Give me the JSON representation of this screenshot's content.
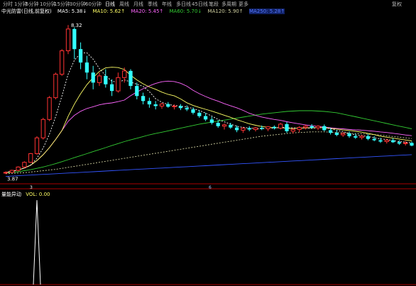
{
  "topbar": {
    "tabs": [
      {
        "label": "分时",
        "active": false
      },
      {
        "label": "1分钟",
        "active": false
      },
      {
        "label": "5分钟",
        "active": false
      },
      {
        "label": "10分钟",
        "active": false
      },
      {
        "label": "15分钟",
        "active": false
      },
      {
        "label": "30分钟",
        "active": false
      },
      {
        "label": "60分钟",
        "active": false
      },
      {
        "label": "日线",
        "active": true
      },
      {
        "label": "周线",
        "active": false
      },
      {
        "label": "月线",
        "active": false
      },
      {
        "label": "季线",
        "active": false
      },
      {
        "label": "年线",
        "active": false
      },
      {
        "label": "多日线",
        "active": false
      },
      {
        "label": "45日线",
        "active": false
      },
      {
        "label": "笔段",
        "active": false
      },
      {
        "label": "多周期",
        "active": false
      },
      {
        "label": "更多",
        "active": false
      }
    ],
    "right_label": "复权"
  },
  "indicator_line": {
    "title": "中光防雷(日线,前复权)",
    "ma5": "MA5: 5.38↓",
    "ma10": "MA10: 5.62↑",
    "ma20": "MA20: 5.45↑",
    "ma60": "MA60: 5.70↓",
    "ma120": "MA120: 5.90↑",
    "ma250": "MA250: 5.28↑"
  },
  "sub_panel": {
    "title": "量能异动",
    "value": "VOL: 0.00"
  },
  "colors": {
    "up": "#ff3333",
    "down": "#33ffff",
    "ma5": "#ffffff",
    "ma10": "#ffff66",
    "ma20": "#ff66ff",
    "ma60": "#33cc33",
    "ma120": "#d0d0a0",
    "ma250": "#3355ff",
    "axis": "#aa0000"
  },
  "chart_data": {
    "type": "candlestick",
    "high_label": "8.32",
    "low_label": "3.87",
    "marker_a": "3",
    "marker_b": "6",
    "ylim": [
      3.6,
      8.6
    ],
    "candles": [
      [
        3.9,
        3.95,
        3.87,
        3.92
      ],
      [
        3.92,
        4.0,
        3.9,
        3.98
      ],
      [
        3.98,
        4.1,
        3.95,
        4.08
      ],
      [
        4.08,
        4.25,
        4.05,
        4.22
      ],
      [
        4.22,
        4.5,
        4.2,
        4.48
      ],
      [
        4.48,
        5.0,
        4.45,
        4.95
      ],
      [
        4.95,
        5.55,
        4.9,
        5.5
      ],
      [
        5.5,
        6.2,
        5.45,
        6.15
      ],
      [
        6.15,
        6.9,
        6.1,
        6.85
      ],
      [
        6.85,
        7.6,
        6.8,
        7.55
      ],
      [
        7.55,
        8.32,
        7.45,
        8.2
      ],
      [
        8.2,
        8.25,
        7.3,
        7.6
      ],
      [
        7.6,
        7.8,
        7.0,
        7.2
      ],
      [
        7.2,
        7.4,
        6.7,
        6.9
      ],
      [
        6.9,
        7.1,
        6.4,
        6.6
      ],
      [
        6.6,
        6.9,
        6.5,
        6.8
      ],
      [
        6.8,
        7.0,
        6.45,
        6.55
      ],
      [
        6.55,
        6.7,
        6.2,
        6.35
      ],
      [
        6.35,
        6.9,
        6.3,
        6.75
      ],
      [
        6.75,
        7.05,
        6.6,
        6.95
      ],
      [
        6.95,
        7.0,
        6.4,
        6.5
      ],
      [
        6.5,
        6.6,
        6.1,
        6.2
      ],
      [
        6.2,
        6.3,
        5.95,
        6.05
      ],
      [
        6.05,
        6.15,
        5.85,
        5.95
      ],
      [
        5.95,
        6.05,
        5.8,
        5.9
      ],
      [
        5.9,
        6.0,
        5.82,
        5.96
      ],
      [
        5.96,
        6.02,
        5.85,
        5.88
      ],
      [
        5.88,
        5.95,
        5.8,
        5.9
      ],
      [
        5.9,
        5.96,
        5.78,
        5.84
      ],
      [
        5.84,
        5.92,
        5.75,
        5.8
      ],
      [
        5.8,
        5.86,
        5.65,
        5.7
      ],
      [
        5.7,
        5.78,
        5.55,
        5.6
      ],
      [
        5.6,
        5.7,
        5.45,
        5.5
      ],
      [
        5.5,
        5.58,
        5.35,
        5.4
      ],
      [
        5.4,
        5.48,
        5.25,
        5.3
      ],
      [
        5.3,
        5.38,
        5.2,
        5.34
      ],
      [
        5.34,
        5.4,
        5.22,
        5.26
      ],
      [
        5.26,
        5.32,
        5.12,
        5.18
      ],
      [
        5.18,
        5.28,
        5.1,
        5.24
      ],
      [
        5.24,
        5.3,
        5.15,
        5.2
      ],
      [
        5.2,
        5.28,
        5.14,
        5.25
      ],
      [
        5.25,
        5.32,
        5.18,
        5.22
      ],
      [
        5.22,
        5.3,
        5.15,
        5.28
      ],
      [
        5.28,
        5.32,
        5.2,
        5.24
      ],
      [
        5.24,
        5.4,
        5.2,
        5.36
      ],
      [
        5.36,
        5.42,
        5.1,
        5.15
      ],
      [
        5.15,
        5.25,
        5.08,
        5.2
      ],
      [
        5.2,
        5.3,
        5.12,
        5.26
      ],
      [
        5.26,
        5.34,
        5.2,
        5.3
      ],
      [
        5.3,
        5.36,
        5.22,
        5.25
      ],
      [
        5.25,
        5.33,
        5.18,
        5.3
      ],
      [
        5.3,
        5.35,
        5.15,
        5.18
      ],
      [
        5.18,
        5.24,
        5.05,
        5.1
      ],
      [
        5.1,
        5.18,
        5.0,
        5.04
      ],
      [
        5.04,
        5.12,
        4.98,
        5.08
      ],
      [
        5.08,
        5.14,
        4.95,
        5.0
      ],
      [
        5.0,
        5.08,
        4.92,
        4.96
      ],
      [
        4.96,
        5.04,
        4.9,
        5.0
      ],
      [
        5.0,
        5.06,
        4.88,
        4.92
      ],
      [
        4.92,
        5.0,
        4.85,
        4.88
      ],
      [
        4.88,
        4.95,
        4.8,
        4.84
      ],
      [
        4.84,
        4.92,
        4.78,
        4.88
      ],
      [
        4.88,
        4.94,
        4.8,
        4.82
      ],
      [
        4.82,
        4.88,
        4.74,
        4.78
      ],
      [
        4.78,
        4.86,
        4.72,
        4.8
      ],
      [
        4.8,
        4.84,
        4.7,
        4.72
      ]
    ],
    "ma60": [
      3.9,
      3.92,
      3.94,
      3.97,
      4.0,
      4.04,
      4.08,
      4.13,
      4.18,
      4.24,
      4.3,
      4.36,
      4.42,
      4.48,
      4.54,
      4.6,
      4.66,
      4.72,
      4.78,
      4.84,
      4.89,
      4.94,
      4.99,
      5.04,
      5.08,
      5.12,
      5.16,
      5.2,
      5.24,
      5.28,
      5.32,
      5.36,
      5.39,
      5.42,
      5.45,
      5.48,
      5.51,
      5.54,
      5.57,
      5.6,
      5.63,
      5.66,
      5.68,
      5.7,
      5.72,
      5.74,
      5.75,
      5.76,
      5.76,
      5.76,
      5.75,
      5.74,
      5.72,
      5.7,
      5.66,
      5.62,
      5.58,
      5.54,
      5.5,
      5.46,
      5.42,
      5.38,
      5.34,
      5.3,
      5.26,
      5.22
    ],
    "ma120": [
      3.88,
      3.89,
      3.9,
      3.91,
      3.93,
      3.95,
      3.97,
      3.99,
      4.01,
      4.04,
      4.07,
      4.1,
      4.13,
      4.16,
      4.19,
      4.22,
      4.25,
      4.28,
      4.31,
      4.34,
      4.37,
      4.4,
      4.43,
      4.46,
      4.49,
      4.52,
      4.55,
      4.58,
      4.61,
      4.64,
      4.67,
      4.7,
      4.73,
      4.76,
      4.79,
      4.82,
      4.85,
      4.88,
      4.91,
      4.94,
      4.97,
      5.0,
      5.02,
      5.04,
      5.06,
      5.08,
      5.1,
      5.11,
      5.12,
      5.13,
      5.13,
      5.13,
      5.12,
      5.11,
      5.1,
      5.09,
      5.08,
      5.07,
      5.06,
      5.05,
      5.03,
      5.01,
      4.99,
      4.97,
      4.95,
      4.93
    ],
    "ma250": [
      3.8,
      3.81,
      3.82,
      3.83,
      3.84,
      3.85,
      3.86,
      3.87,
      3.88,
      3.89,
      3.9,
      3.91,
      3.92,
      3.93,
      3.94,
      3.95,
      3.96,
      3.97,
      3.98,
      3.99,
      4.0,
      4.01,
      4.02,
      4.03,
      4.04,
      4.05,
      4.06,
      4.07,
      4.08,
      4.09,
      4.1,
      4.11,
      4.12,
      4.13,
      4.14,
      4.15,
      4.16,
      4.17,
      4.18,
      4.19,
      4.2,
      4.21,
      4.22,
      4.23,
      4.24,
      4.25,
      4.26,
      4.27,
      4.28,
      4.29,
      4.3,
      4.31,
      4.32,
      4.33,
      4.34,
      4.35,
      4.36,
      4.37,
      4.38,
      4.39,
      4.4,
      4.41,
      4.42,
      4.43,
      4.44,
      4.45
    ],
    "sub_spike_index": 5
  }
}
